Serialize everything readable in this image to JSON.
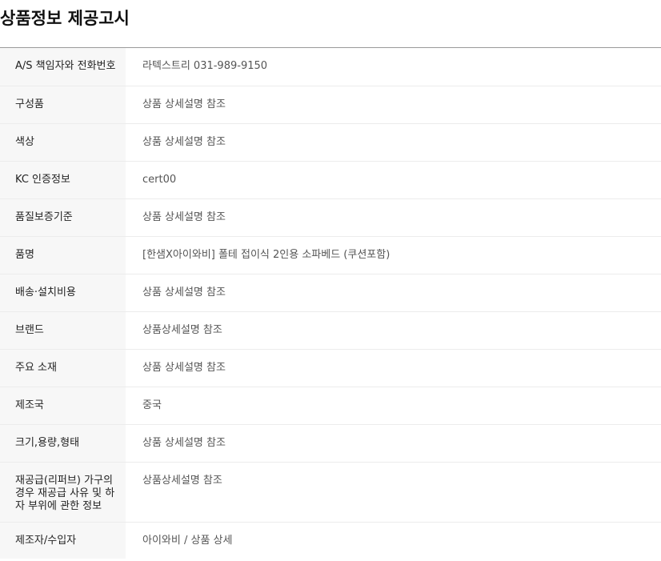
{
  "title": "상품정보 제공고시",
  "rows": [
    {
      "label": "A/S 책임자와 전화번호",
      "value": "라텍스트리 031-989-9150"
    },
    {
      "label": "구성품",
      "value": "상품 상세설명 참조"
    },
    {
      "label": "색상",
      "value": "상품 상세설명 참조"
    },
    {
      "label": "KC 인증정보",
      "value": "cert00"
    },
    {
      "label": "품질보증기준",
      "value": "상품 상세설명 참조"
    },
    {
      "label": "품명",
      "value": "[한샘X아이와비] 폴테 접이식 2인용 소파베드 (쿠션포함)"
    },
    {
      "label": "배송·설치비용",
      "value": "상품 상세설명 참조"
    },
    {
      "label": "브랜드",
      "value": "상품상세설명 참조"
    },
    {
      "label": "주요 소재",
      "value": "상품 상세설명 참조"
    },
    {
      "label": "제조국",
      "value": "중국"
    },
    {
      "label": "크기,용량,형태",
      "value": "상품 상세설명 참조"
    },
    {
      "label": "재공급(리퍼브) 가구의 경우 재공급 사유 및 하자 부위에 관한 정보",
      "value": "상품상세설명 참조"
    },
    {
      "label": "제조자/수입자",
      "value": "아이와비 / 상품 상세"
    }
  ]
}
